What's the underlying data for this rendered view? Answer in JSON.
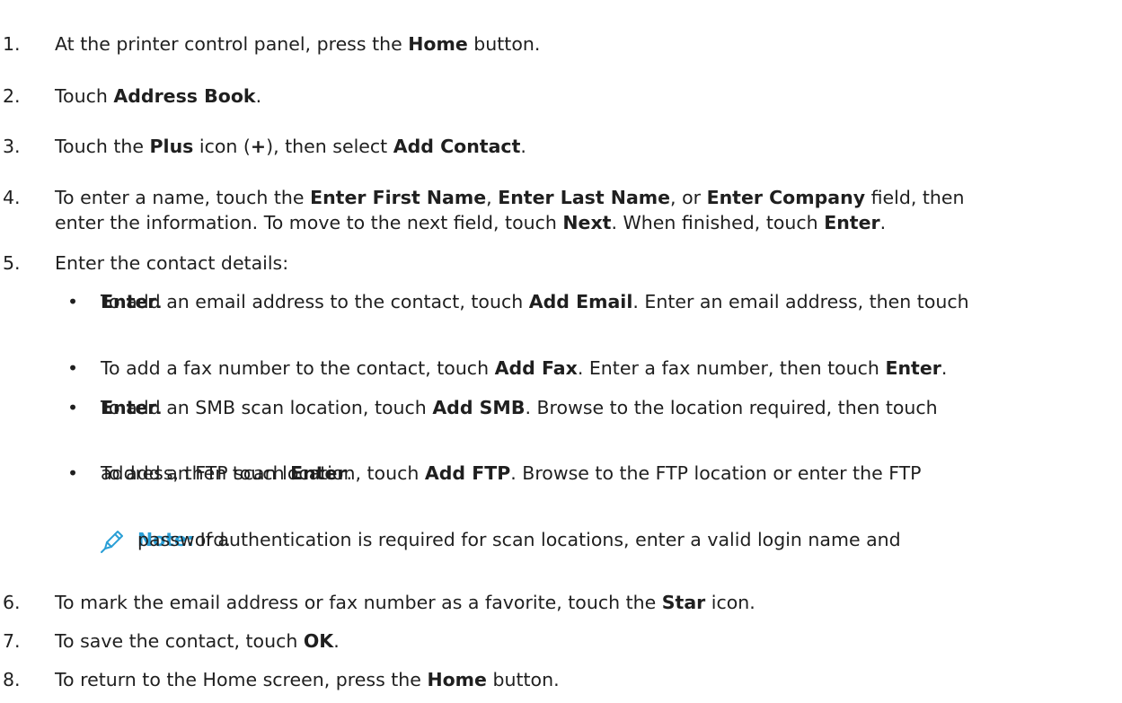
{
  "steps": [
    {
      "num": "1.",
      "parts": [
        "At the printer control panel, press the ",
        "Home",
        " button."
      ]
    },
    {
      "num": "2.",
      "parts": [
        "Touch ",
        "Address Book",
        "."
      ]
    },
    {
      "num": "3.",
      "parts": [
        "Touch the ",
        "Plus",
        " icon (",
        "+",
        "), then select ",
        "Add Contact",
        "."
      ]
    },
    {
      "num": "4.",
      "line1": [
        "To enter a name, touch the ",
        "Enter First Name",
        ", ",
        "Enter Last Name",
        ", or ",
        "Enter Company",
        " field, then"
      ],
      "line2": [
        "enter the information. To move to the next field, touch ",
        "Next",
        ". When finished, touch ",
        "Enter",
        "."
      ]
    },
    {
      "num": "5.",
      "parts": [
        "Enter the contact details:"
      ]
    },
    {
      "num": "6.",
      "parts": [
        "To mark the email address or fax number as a favorite, touch the ",
        "Star",
        " icon."
      ]
    },
    {
      "num": "7.",
      "parts": [
        "To save the contact, touch ",
        "OK",
        "."
      ]
    },
    {
      "num": "8.",
      "parts": [
        "To return to the Home screen, press the ",
        "Home",
        " button."
      ]
    }
  ],
  "bullets": [
    {
      "marker": "•",
      "line1": [
        "To add an email address to the contact, touch ",
        "Add Email",
        ". Enter an email address, then touch"
      ],
      "line2": [
        "",
        "Enter",
        "."
      ]
    },
    {
      "marker": "•",
      "line1": [
        "To add a fax number to the contact, touch ",
        "Add Fax",
        ". Enter a fax number, then touch ",
        "Enter",
        "."
      ]
    },
    {
      "marker": "•",
      "line1": [
        "To add an SMB scan location, touch ",
        "Add SMB",
        ". Browse to the location required, then touch"
      ],
      "line2": [
        "",
        "Enter",
        "."
      ]
    },
    {
      "marker": "•",
      "line1": [
        "To add an FTP scan location, touch ",
        "Add FTP",
        ". Browse to the FTP location or enter the FTP"
      ],
      "line2": [
        "address, then touch ",
        "Enter",
        "."
      ]
    }
  ],
  "note": {
    "icon": "pencil-icon",
    "label": "Note:",
    "line1": " If authentication is required for scan locations, enter a valid login name and",
    "line2": "password.",
    "color": "#2a9fd6"
  }
}
